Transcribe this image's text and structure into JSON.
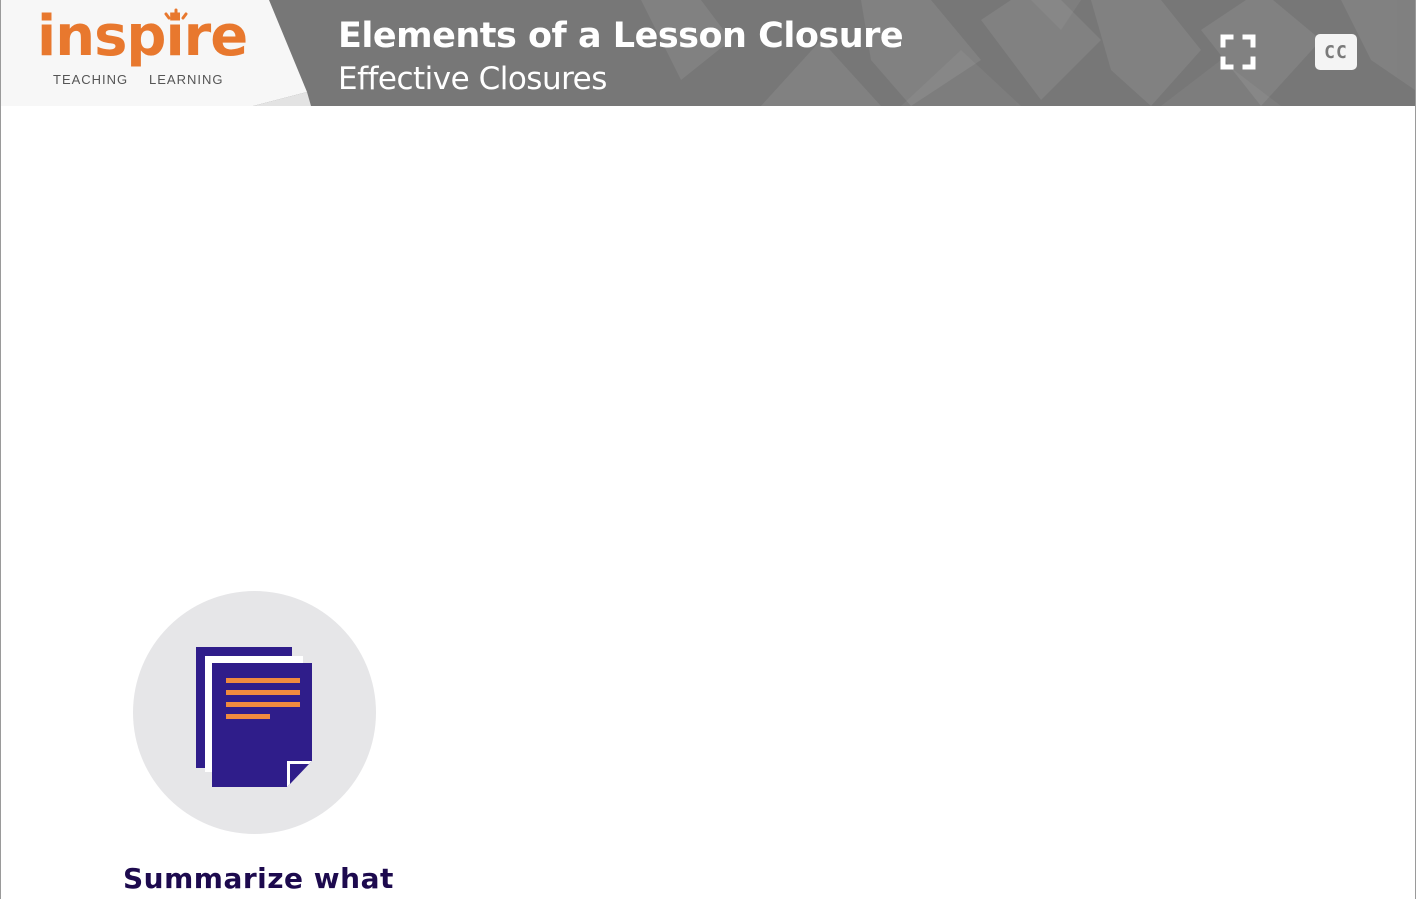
{
  "header": {
    "logo": {
      "word": "inspire",
      "sub_left": "TEACHING",
      "sub_right": "LEARNING"
    },
    "title": "Elements of a Lesson Closure",
    "subtitle": "Effective Closures",
    "controls": {
      "fullscreen_icon": "fullscreen-icon",
      "cc_label": "CC"
    }
  },
  "content": {
    "items": [
      {
        "icon": "documents-icon",
        "caption": "Summarize what"
      }
    ]
  },
  "colors": {
    "header_bg": "#7a7a7a",
    "brand_orange": "#e8782e",
    "caption_navy": "#1d0a4e",
    "doc_purple": "#2f1d8a",
    "circle_gray": "#e6e6e8"
  }
}
